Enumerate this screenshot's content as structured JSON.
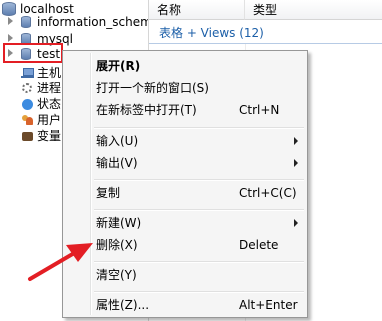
{
  "tree": {
    "server": "localhost",
    "databases": [
      "information_schema",
      "mysql",
      "test"
    ],
    "tools": [
      "主机",
      "进程",
      "状态",
      "用户",
      "变量"
    ]
  },
  "grid": {
    "col_name": "名称",
    "col_type": "类型",
    "group": "表格 + Views (12)"
  },
  "menu": {
    "open": "展开(R)",
    "open_new_window": "打开一个新的窗口(S)",
    "open_new_tab": "在新标签中打开(T)",
    "open_new_tab_shortcut": "Ctrl+N",
    "import": "输入(U)",
    "export": "输出(V)",
    "copy": "复制",
    "copy_shortcut": "Ctrl+C(C)",
    "new": "新建(W)",
    "delete": "删除(X)",
    "delete_shortcut": "Delete",
    "clear": "清空(Y)",
    "properties": "属性(Z)...",
    "properties_shortcut": "Alt+Enter"
  },
  "colors": {
    "highlight_red": "#e31e24",
    "group_blue": "#1c5fa8"
  }
}
